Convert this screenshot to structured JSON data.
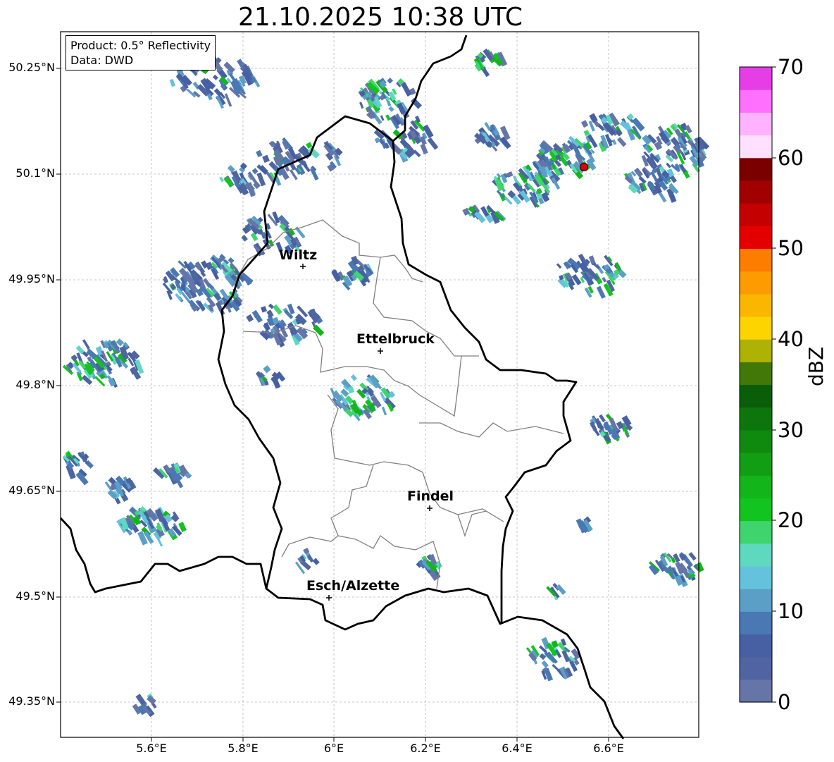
{
  "title": "21.10.2025 10:38 UTC",
  "info": {
    "product": "Product: 0.5° Reflectivity",
    "data": "Data: DWD"
  },
  "lat_labels": [
    "50.25°N",
    "50.1°N",
    "49.95°N",
    "49.8°N",
    "49.65°N",
    "49.5°N",
    "49.35°N"
  ],
  "lon_labels": [
    "5.6°E",
    "5.8°E",
    "6°E",
    "6.2°E",
    "6.4°E",
    "6.6°E"
  ],
  "cities": [
    {
      "name": "Wiltz"
    },
    {
      "name": "Ettelbruck"
    },
    {
      "name": "Findel"
    },
    {
      "name": "Esch/Alzette"
    }
  ],
  "colorbar": {
    "label": "dBZ",
    "ticks": [
      "70",
      "60",
      "50",
      "40",
      "30",
      "20",
      "10",
      "0"
    ],
    "colors": [
      "#6675a8",
      "#4f64a0",
      "#4660a3",
      "#4a78b3",
      "#5b9fc6",
      "#65c2dc",
      "#5fd8c0",
      "#3fd46d",
      "#12c41e",
      "#12b51a",
      "#129e14",
      "#0f8a0f",
      "#0c760c",
      "#0a5e0a",
      "#427808",
      "#adb205",
      "#fdd400",
      "#fbb600",
      "#fd9b00",
      "#fd7d00",
      "#e50000",
      "#c40000",
      "#a00000",
      "#7a0000",
      "#ffe0ff",
      "#ffb3ff",
      "#ff70ff",
      "#e63ee6"
    ]
  },
  "radar_site_color": "#e00000"
}
